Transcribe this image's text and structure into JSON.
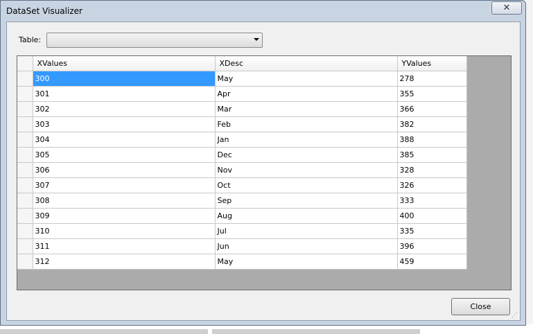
{
  "window": {
    "title": "DataSet Visualizer",
    "close_glyph": "✕"
  },
  "toolbar": {
    "table_label": "Table:",
    "table_value": ""
  },
  "grid": {
    "columns": [
      "XValues",
      "XDesc",
      "YValues"
    ],
    "rows": [
      [
        "300",
        "May",
        "278"
      ],
      [
        "301",
        "Apr",
        "355"
      ],
      [
        "302",
        "Mar",
        "366"
      ],
      [
        "303",
        "Feb",
        "382"
      ],
      [
        "304",
        "Jan",
        "388"
      ],
      [
        "305",
        "Dec",
        "385"
      ],
      [
        "306",
        "Nov",
        "328"
      ],
      [
        "307",
        "Oct",
        "326"
      ],
      [
        "308",
        "Sep",
        "333"
      ],
      [
        "309",
        "Aug",
        "400"
      ],
      [
        "310",
        "Jul",
        "335"
      ],
      [
        "311",
        "Jun",
        "396"
      ],
      [
        "312",
        "May",
        "459"
      ]
    ],
    "selected_row": 0
  },
  "footer": {
    "close_label": "Close"
  },
  "colors": {
    "selection": "#3399ff",
    "grid_background": "#ababab"
  }
}
